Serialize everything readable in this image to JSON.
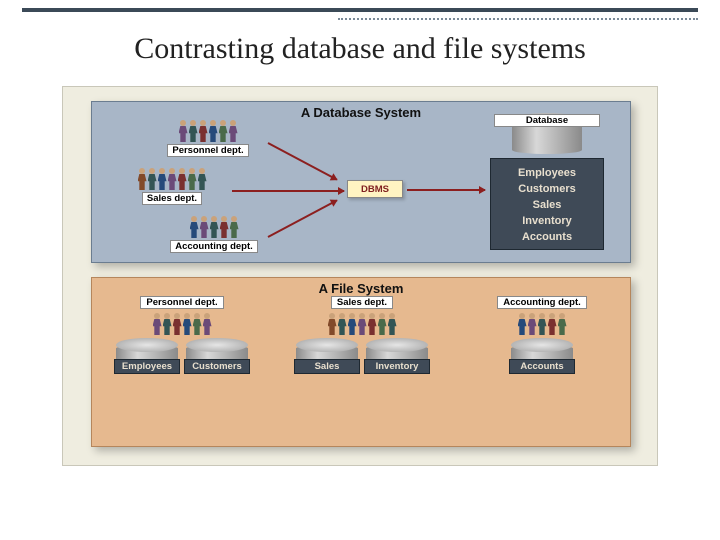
{
  "slide": {
    "title": "Contrasting database and file systems"
  },
  "db_panel": {
    "title": "A Database System",
    "depts": {
      "personnel": "Personnel dept.",
      "sales": "Sales dept.",
      "accounting": "Accounting dept."
    },
    "dbms_label": "DBMS",
    "database_label": "Database",
    "db_items": [
      "Employees",
      "Customers",
      "Sales",
      "Inventory",
      "Accounts"
    ]
  },
  "fs_panel": {
    "title": "A File System",
    "columns": [
      {
        "dept": "Personnel dept.",
        "files": [
          "Employees",
          "Customers"
        ]
      },
      {
        "dept": "Sales dept.",
        "files": [
          "Sales",
          "Inventory"
        ]
      },
      {
        "dept": "Accounting dept.",
        "files": [
          "Accounts"
        ]
      }
    ]
  }
}
